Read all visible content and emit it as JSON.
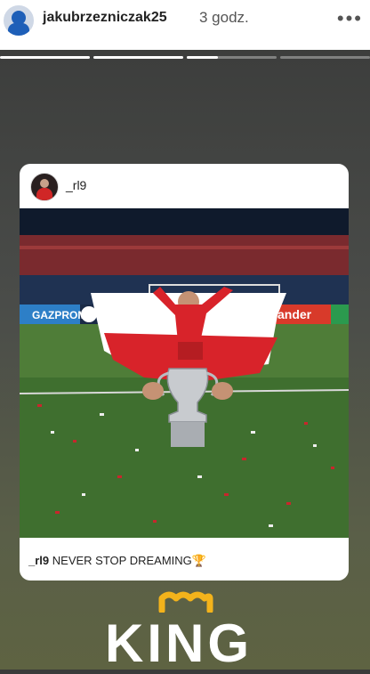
{
  "header": {
    "username": "jakubrzezniczak25",
    "time": "3 godz.",
    "more_icon": "more-horizontal-icon"
  },
  "story_progress": {
    "segments": 4,
    "current_index": 2,
    "current_fill": 0.35
  },
  "card": {
    "username": "_rl9",
    "caption_user": "_rl9",
    "caption_text": "NEVER STOP DREAMING🏆"
  },
  "photo": {
    "boards": {
      "left": "GAZPROM",
      "right": "ander"
    }
  },
  "sticker": {
    "text": "KING"
  }
}
